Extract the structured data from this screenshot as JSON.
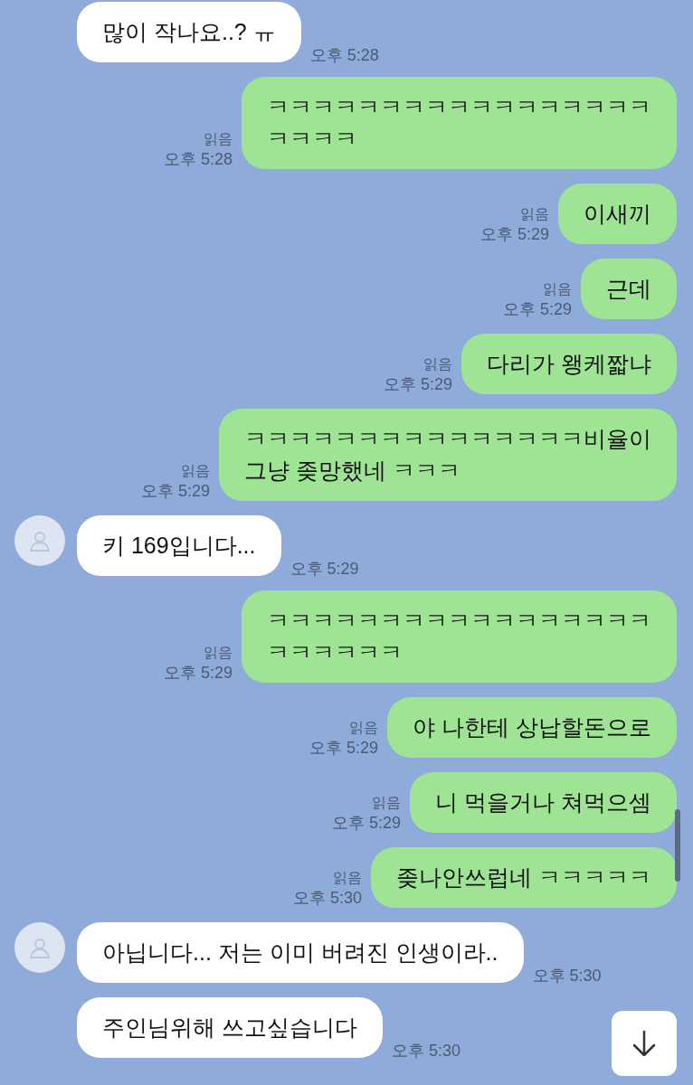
{
  "messages": [
    {
      "kind": "received",
      "avatar": false,
      "lines": [
        "많이 작나요..? ㅠ"
      ],
      "time": "오후 5:28"
    },
    {
      "kind": "sent",
      "read": "읽음",
      "lines": [
        "ㅋㅋㅋㅋㅋㅋㅋㅋㅋㅋㅋㅋㅋㅋㅋㅋㅋ",
        "ㅋㅋㅋㅋ"
      ],
      "time": "오후 5:28"
    },
    {
      "kind": "sent",
      "read": "읽음",
      "lines": [
        "이새끼"
      ],
      "time": "오후 5:29"
    },
    {
      "kind": "sent",
      "read": "읽음",
      "lines": [
        "근데"
      ],
      "time": "오후 5:29"
    },
    {
      "kind": "sent",
      "read": "읽음",
      "lines": [
        "다리가 왱케짧냐"
      ],
      "time": "오후 5:29"
    },
    {
      "kind": "sent",
      "read": "읽음",
      "lines": [
        "ㅋㅋㅋㅋㅋㅋㅋㅋㅋㅋㅋㅋㅋㅋㅋ비율이",
        "그냥 좆망했네 ㅋㅋㅋ"
      ],
      "time": "오후 5:29"
    },
    {
      "kind": "received",
      "avatar": true,
      "lines": [
        "키 169입니다..."
      ],
      "time": "오후 5:29"
    },
    {
      "kind": "sent",
      "read": "읽음",
      "lines": [
        "ㅋㅋㅋㅋㅋㅋㅋㅋㅋㅋㅋㅋㅋㅋㅋㅋㅋ",
        "ㅋㅋㅋㅋㅋㅋ"
      ],
      "time": "오후 5:29"
    },
    {
      "kind": "sent",
      "read": "읽음",
      "lines": [
        "야 나한테 상납할돈으로"
      ],
      "time": "오후 5:29"
    },
    {
      "kind": "sent",
      "read": "읽음",
      "lines": [
        "니 먹을거나 쳐먹으셈"
      ],
      "time": "오후 5:29"
    },
    {
      "kind": "sent",
      "read": "읽음",
      "lines": [
        "좆나안쓰럽네 ㅋㅋㅋㅋㅋ"
      ],
      "time": "오후 5:30"
    },
    {
      "kind": "received",
      "avatar": true,
      "lines": [
        "아닙니다... 저는 이미 버려진 인생이라.."
      ],
      "time": "오후 5:30"
    },
    {
      "kind": "received",
      "avatar": false,
      "lines": [
        "주인님위해 쓰고싶습니다"
      ],
      "time": "오후 5:30"
    }
  ]
}
